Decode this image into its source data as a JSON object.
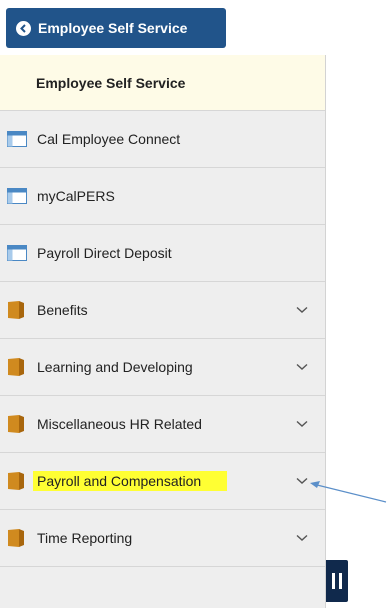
{
  "header": {
    "back_button_label": "Employee Self Service"
  },
  "panel": {
    "title": "Employee Self Service",
    "items": [
      {
        "label": "Cal Employee Connect",
        "icon": "page-icon",
        "expandable": false
      },
      {
        "label": "myCalPERS",
        "icon": "page-icon",
        "expandable": false
      },
      {
        "label": "Payroll Direct Deposit",
        "icon": "page-icon",
        "expandable": false
      },
      {
        "label": "Benefits",
        "icon": "folder-icon",
        "expandable": true
      },
      {
        "label": "Learning and Developing",
        "icon": "folder-icon",
        "expandable": true
      },
      {
        "label": "Miscellaneous HR Related",
        "icon": "folder-icon",
        "expandable": true
      },
      {
        "label": "Payroll and Compensation",
        "icon": "folder-icon",
        "expandable": true,
        "highlighted": true
      },
      {
        "label": "Time Reporting",
        "icon": "folder-icon",
        "expandable": true
      }
    ]
  },
  "colors": {
    "header_button": "#21548a",
    "panel_title_bg": "#fefbe7",
    "panel_bg": "#eeeeee",
    "highlight": "#ffff33",
    "folder": "#d08a1f",
    "annotation_arrow": "#5b8fc9",
    "collapse_handle": "#10294c"
  }
}
